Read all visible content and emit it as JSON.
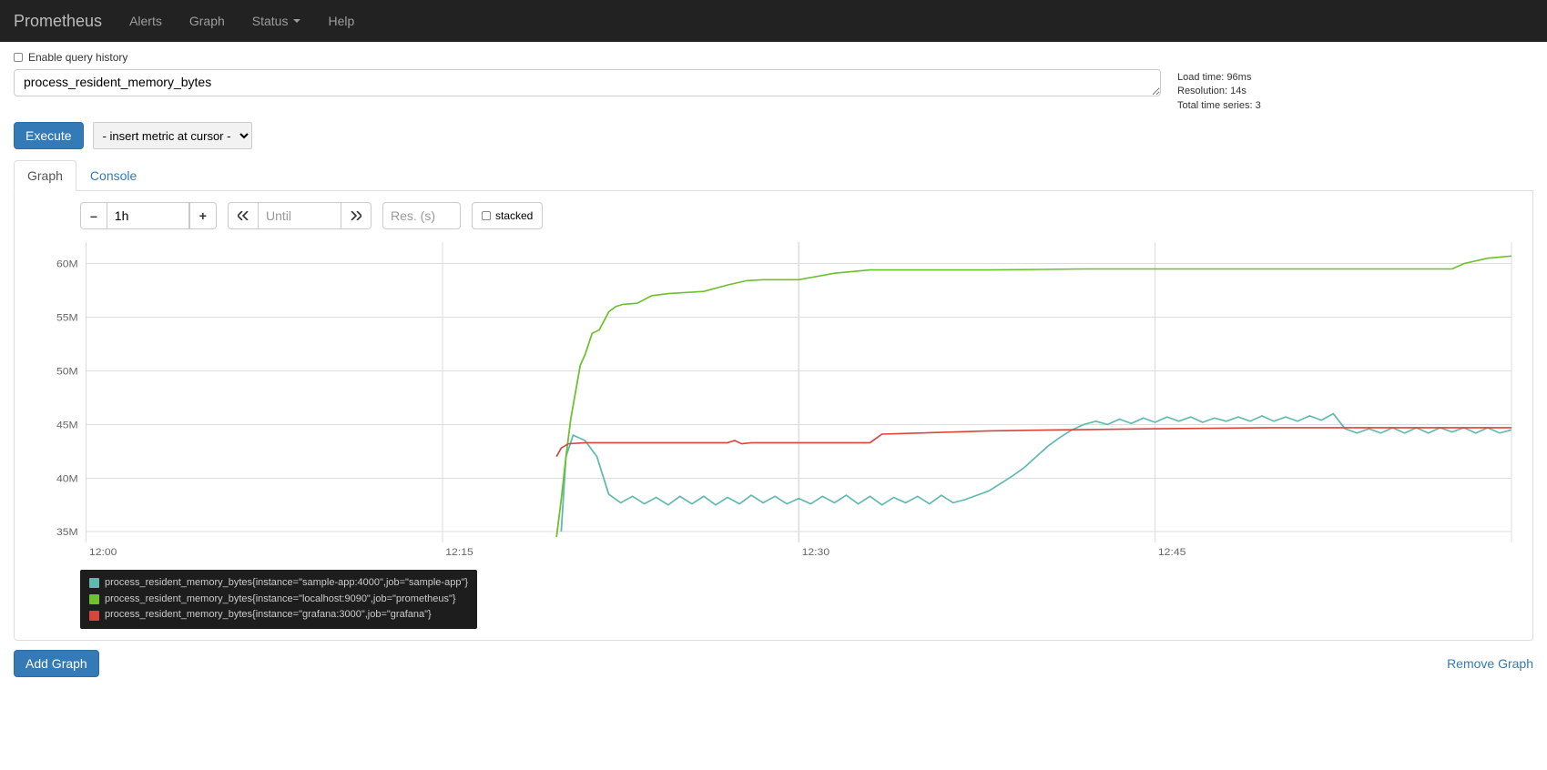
{
  "navbar": {
    "brand": "Prometheus",
    "links": [
      "Alerts",
      "Graph",
      "Status",
      "Help"
    ]
  },
  "history_checkbox_label": "Enable query history",
  "query_value": "process_resident_memory_bytes",
  "stats": {
    "load_time": "Load time: 96ms",
    "resolution": "Resolution: 14s",
    "total_series": "Total time series: 3"
  },
  "execute_label": "Execute",
  "metric_select_placeholder": "- insert metric at cursor -",
  "tabs": {
    "graph": "Graph",
    "console": "Console"
  },
  "range_controls": {
    "minus": "–",
    "value": "1h",
    "plus": "+",
    "until_placeholder": "Until",
    "res_placeholder": "Res. (s)",
    "stacked_label": "stacked"
  },
  "remove_graph_label": "Remove Graph",
  "add_graph_label": "Add Graph",
  "legend": {
    "items": [
      {
        "color": "#5fb9b0",
        "label": "process_resident_memory_bytes{instance=\"sample-app:4000\",job=\"sample-app\"}"
      },
      {
        "color": "#6ec02f",
        "label": "process_resident_memory_bytes{instance=\"localhost:9090\",job=\"prometheus\"}"
      },
      {
        "color": "#d9453b",
        "label": "process_resident_memory_bytes{instance=\"grafana:3000\",job=\"grafana\"}"
      }
    ]
  },
  "chart_data": {
    "type": "line",
    "xlabel": "",
    "ylabel": "",
    "x_ticks": [
      "12:00",
      "12:15",
      "12:30",
      "12:45"
    ],
    "y_ticks": [
      "35M",
      "40M",
      "45M",
      "50M",
      "55M",
      "60M"
    ],
    "y_range": [
      34000000,
      62000000
    ],
    "x_range_minutes": [
      0,
      60
    ],
    "series": [
      {
        "name": "sample-app:4000",
        "color": "#5fb9b0",
        "points": [
          [
            20.0,
            35000000
          ],
          [
            20.2,
            42000000
          ],
          [
            20.5,
            44000000
          ],
          [
            21.0,
            43500000
          ],
          [
            21.5,
            42000000
          ],
          [
            22.0,
            38500000
          ],
          [
            22.5,
            37700000
          ],
          [
            23.0,
            38300000
          ],
          [
            23.5,
            37600000
          ],
          [
            24.0,
            38200000
          ],
          [
            24.5,
            37500000
          ],
          [
            25.0,
            38300000
          ],
          [
            25.5,
            37600000
          ],
          [
            26.0,
            38300000
          ],
          [
            26.5,
            37500000
          ],
          [
            27.0,
            38200000
          ],
          [
            27.5,
            37600000
          ],
          [
            28.0,
            38400000
          ],
          [
            28.5,
            37700000
          ],
          [
            29.0,
            38300000
          ],
          [
            29.5,
            37600000
          ],
          [
            30.0,
            38100000
          ],
          [
            30.5,
            37600000
          ],
          [
            31.0,
            38300000
          ],
          [
            31.5,
            37700000
          ],
          [
            32.0,
            38400000
          ],
          [
            32.5,
            37600000
          ],
          [
            33.0,
            38300000
          ],
          [
            33.5,
            37500000
          ],
          [
            34.0,
            38200000
          ],
          [
            34.5,
            37700000
          ],
          [
            35.0,
            38300000
          ],
          [
            35.5,
            37600000
          ],
          [
            36.0,
            38400000
          ],
          [
            36.5,
            37700000
          ],
          [
            37.0,
            38000000
          ],
          [
            37.5,
            38400000
          ],
          [
            38.0,
            38800000
          ],
          [
            38.5,
            39500000
          ],
          [
            39.0,
            40200000
          ],
          [
            39.5,
            41000000
          ],
          [
            40.0,
            42000000
          ],
          [
            40.5,
            43000000
          ],
          [
            41.0,
            43800000
          ],
          [
            41.5,
            44500000
          ],
          [
            42.0,
            45000000
          ],
          [
            42.5,
            45300000
          ],
          [
            43.0,
            45000000
          ],
          [
            43.5,
            45500000
          ],
          [
            44.0,
            45100000
          ],
          [
            44.5,
            45600000
          ],
          [
            45.0,
            45200000
          ],
          [
            45.5,
            45700000
          ],
          [
            46.0,
            45300000
          ],
          [
            46.5,
            45700000
          ],
          [
            47.0,
            45200000
          ],
          [
            47.5,
            45600000
          ],
          [
            48.0,
            45300000
          ],
          [
            48.5,
            45700000
          ],
          [
            49.0,
            45300000
          ],
          [
            49.5,
            45800000
          ],
          [
            50.0,
            45300000
          ],
          [
            50.5,
            45700000
          ],
          [
            51.0,
            45300000
          ],
          [
            51.5,
            45800000
          ],
          [
            52.0,
            45400000
          ],
          [
            52.5,
            46000000
          ],
          [
            53.0,
            44600000
          ],
          [
            53.5,
            44200000
          ],
          [
            54.0,
            44600000
          ],
          [
            54.5,
            44200000
          ],
          [
            55.0,
            44700000
          ],
          [
            55.5,
            44200000
          ],
          [
            56.0,
            44700000
          ],
          [
            56.5,
            44200000
          ],
          [
            57.0,
            44700000
          ],
          [
            57.5,
            44300000
          ],
          [
            58.0,
            44700000
          ],
          [
            58.5,
            44200000
          ],
          [
            59.0,
            44700000
          ],
          [
            59.5,
            44200000
          ],
          [
            60.0,
            44500000
          ]
        ]
      },
      {
        "name": "localhost:9090",
        "color": "#6ec02f",
        "points": [
          [
            19.8,
            34500000
          ],
          [
            20.0,
            38000000
          ],
          [
            20.2,
            42000000
          ],
          [
            20.4,
            45500000
          ],
          [
            20.6,
            48000000
          ],
          [
            20.8,
            50500000
          ],
          [
            21.0,
            51500000
          ],
          [
            21.3,
            53500000
          ],
          [
            21.6,
            53800000
          ],
          [
            22.0,
            55500000
          ],
          [
            22.3,
            56000000
          ],
          [
            22.6,
            56200000
          ],
          [
            23.2,
            56300000
          ],
          [
            23.8,
            57000000
          ],
          [
            24.5,
            57200000
          ],
          [
            25.2,
            57300000
          ],
          [
            26.0,
            57400000
          ],
          [
            27.0,
            58000000
          ],
          [
            27.8,
            58400000
          ],
          [
            28.5,
            58500000
          ],
          [
            29.3,
            58500000
          ],
          [
            30.0,
            58500000
          ],
          [
            31.5,
            59100000
          ],
          [
            33.0,
            59400000
          ],
          [
            35.0,
            59400000
          ],
          [
            38.0,
            59400000
          ],
          [
            42.0,
            59500000
          ],
          [
            46.0,
            59500000
          ],
          [
            50.0,
            59500000
          ],
          [
            55.0,
            59500000
          ],
          [
            57.5,
            59500000
          ],
          [
            58.0,
            60000000
          ],
          [
            59.0,
            60500000
          ],
          [
            60.0,
            60700000
          ]
        ]
      },
      {
        "name": "grafana:3000",
        "color": "#d9453b",
        "points": [
          [
            19.8,
            42000000
          ],
          [
            20.0,
            42800000
          ],
          [
            20.3,
            43200000
          ],
          [
            21.0,
            43300000
          ],
          [
            22.0,
            43300000
          ],
          [
            24.0,
            43300000
          ],
          [
            26.0,
            43300000
          ],
          [
            27.0,
            43300000
          ],
          [
            27.3,
            43500000
          ],
          [
            27.6,
            43200000
          ],
          [
            28.0,
            43300000
          ],
          [
            30.0,
            43300000
          ],
          [
            32.0,
            43300000
          ],
          [
            33.0,
            43300000
          ],
          [
            33.5,
            44100000
          ],
          [
            35.0,
            44200000
          ],
          [
            38.0,
            44400000
          ],
          [
            41.0,
            44500000
          ],
          [
            45.0,
            44600000
          ],
          [
            50.0,
            44700000
          ],
          [
            55.0,
            44700000
          ],
          [
            60.0,
            44700000
          ]
        ]
      }
    ]
  }
}
